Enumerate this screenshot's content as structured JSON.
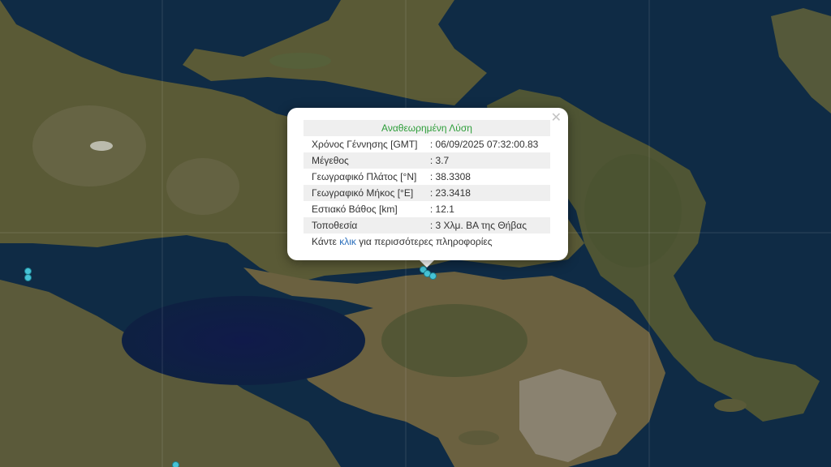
{
  "popup": {
    "title": "Αναθεωρημένη Λύση",
    "close_icon": "close-icon",
    "rows": [
      {
        "label": "Χρόνος Γέννησης [GMT]",
        "value": ": 06/09/2025 07:32:00.83"
      },
      {
        "label": "Μέγεθος",
        "value": ": 3.7"
      },
      {
        "label": "Γεωγραφικό Πλάτος [°N]",
        "value": ": 38.3308"
      },
      {
        "label": "Γεωγραφικό Μήκος [°E]",
        "value": ": 23.3418"
      },
      {
        "label": "Εστιακό Βάθος [km]",
        "value": ": 12.1"
      },
      {
        "label": "Τοποθεσία",
        "value": ": 3 Χλμ. ΒΑ της Θήβας"
      }
    ],
    "more_prefix": "Κάντε ",
    "more_link": "κλικ",
    "more_suffix": " για περισσότερες πληροφορίες"
  },
  "colors": {
    "title": "#2e9e3a",
    "link": "#2a6ebb",
    "marker": "#46c3d6",
    "sea": "#0e2a44",
    "land": "#5d5a38"
  }
}
